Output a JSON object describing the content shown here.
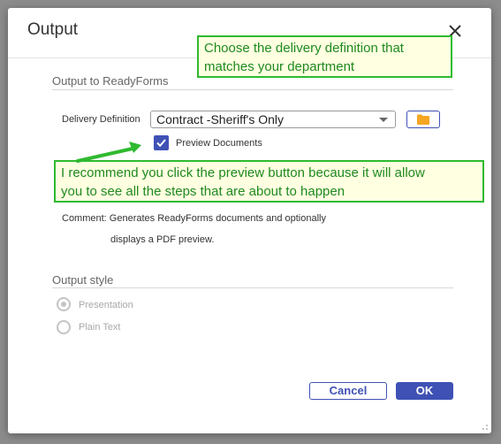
{
  "dialog": {
    "title": "Output",
    "sections": {
      "output_to": "Output to ReadyForms",
      "output_style": "Output style"
    },
    "delivery": {
      "label": "Delivery Definition",
      "selected": "Contract -Sheriff's Only"
    },
    "preview": {
      "label": "Preview Documents",
      "checked": true
    },
    "comment": {
      "line1": "Comment: Generates ReadyForms documents and optionally",
      "line2": "displays a PDF preview."
    },
    "output_style_options": [
      {
        "label": "Presentation",
        "selected": true
      },
      {
        "label": "Plain Text",
        "selected": false
      }
    ],
    "buttons": {
      "cancel": "Cancel",
      "ok": "OK"
    }
  },
  "annotations": {
    "callout_top": {
      "line1": "Choose the delivery definition that",
      "line2": "matches your department"
    },
    "callout_mid": {
      "line1": "I recommend you click the preview button because it will allow",
      "line2": "you to see all the steps that are about to happen"
    }
  },
  "colors": {
    "accent": "#3f51b5",
    "callout_border": "#2fba2f",
    "callout_text": "#1e8a1e",
    "callout_bg": "#ffffe1",
    "folder_icon": "#f5a623"
  },
  "icons": [
    "close-icon",
    "chevron-down-icon",
    "folder-icon",
    "check-icon",
    "resize-grip-icon",
    "arrow-icon"
  ]
}
